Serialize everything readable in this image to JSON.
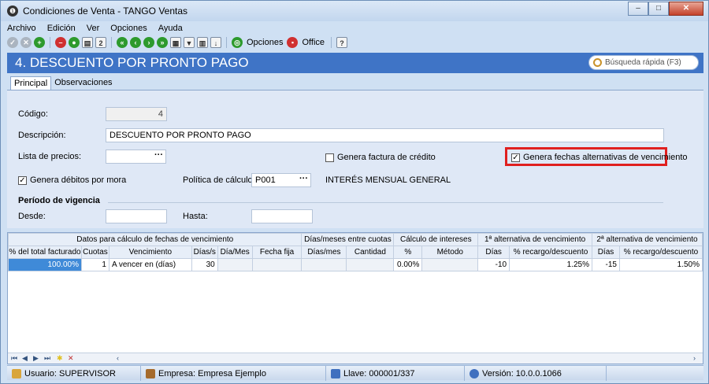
{
  "window": {
    "title": "Condiciones de Venta - TANGO Ventas",
    "min": "–",
    "max": "□",
    "close": "✕"
  },
  "menu": [
    "Archivo",
    "Edición",
    "Ver",
    "Opciones",
    "Ayuda"
  ],
  "toolbar": {
    "opciones_label": "Opciones",
    "office_label": "Office"
  },
  "header": {
    "title": "4. DESCUENTO POR PRONTO PAGO",
    "search_placeholder": "Búsqueda rápida (F3)"
  },
  "tabs": [
    {
      "label": "Principal",
      "active": true
    },
    {
      "label": "Observaciones",
      "active": false
    }
  ],
  "form": {
    "codigo_label": "Código:",
    "codigo_value": "4",
    "descripcion_label": "Descripción:",
    "descripcion_value": "DESCUENTO POR PRONTO PAGO",
    "lista_label": "Lista de precios:",
    "lista_value": "",
    "genera_factura_label": "Genera factura de crédito",
    "genera_factura_checked": false,
    "genera_fechas_label": "Genera fechas alternativas de vencimiento",
    "genera_fechas_checked": true,
    "genera_debitos_label": "Genera débitos por mora",
    "genera_debitos_checked": true,
    "politica_label": "Política de cálculo:",
    "politica_value": "P001",
    "politica_desc": "INTERÉS MENSUAL GENERAL",
    "periodo_title": "Período de vigencia",
    "desde_label": "Desde:",
    "desde_value": "",
    "hasta_label": "Hasta:",
    "hasta_value": ""
  },
  "grid": {
    "groups": [
      "Datos para cálculo de fechas de vencimiento",
      "Días/meses entre cuotas",
      "Cálculo de intereses",
      "1ª alternativa de vencimiento",
      "2ª alternativa de vencimiento"
    ],
    "columns": [
      "% del total facturado",
      "Cuotas",
      "Vencimiento",
      "Días/s",
      "Día/Mes",
      "Fecha fija",
      "Días/mes",
      "Cantidad",
      "%",
      "Método",
      "Días",
      "% recargo/descuento",
      "Días",
      "% recargo/descuento"
    ],
    "rows": [
      [
        "100.00%",
        "1",
        "A vencer en (días)",
        "30",
        "",
        "",
        "",
        "",
        "0.00%",
        "",
        "-10",
        "1.25%",
        "-15",
        "1.50%"
      ]
    ]
  },
  "status": {
    "usuario": "Usuario: SUPERVISOR",
    "empresa": "Empresa: Empresa Ejemplo",
    "llave": "Llave: 000001/337",
    "version": "Versión: 10.0.0.1066"
  },
  "colors": {
    "header": "#3f74c6",
    "highlight": "#e0201f",
    "selected_cell": "#3f8ad8"
  }
}
